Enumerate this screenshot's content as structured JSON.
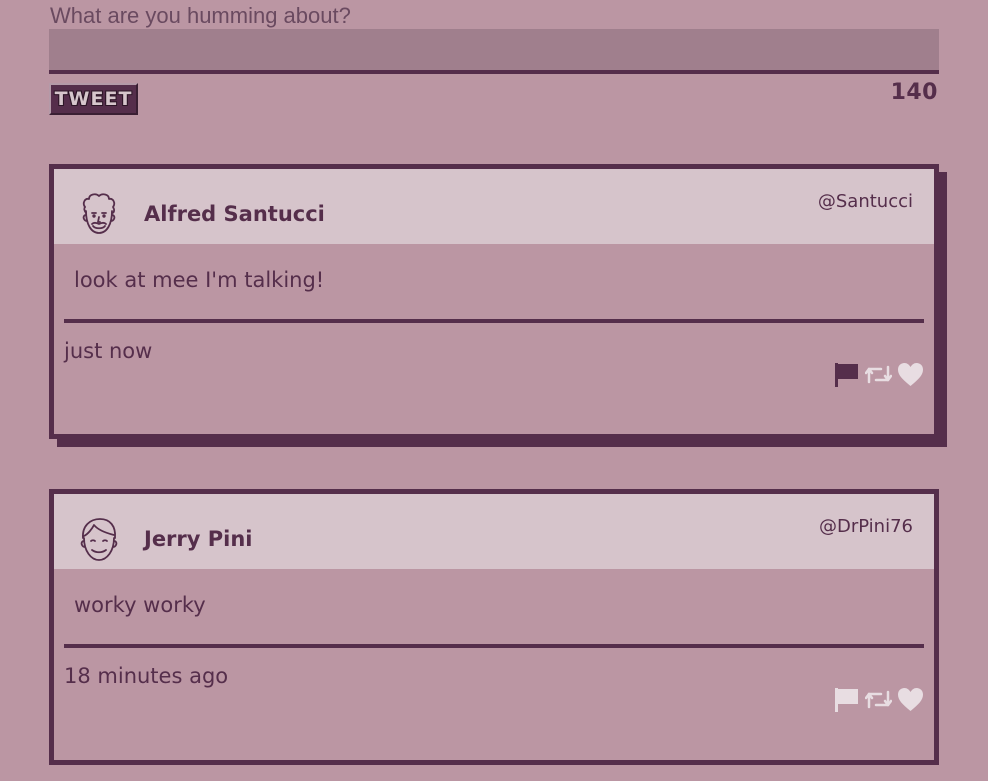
{
  "composer": {
    "prompt": "What are you humming about?",
    "input_value": "",
    "tweet_button_label": "TWEET",
    "char_count": "140"
  },
  "tweets": [
    {
      "user_name": "Alfred Santucci",
      "handle": "@Santucci",
      "text": "look at mee I'm talking!",
      "timestamp": "just now",
      "avatar_icon": "man-curly-hair-avatar-icon",
      "flag_color": "#552e4b"
    },
    {
      "user_name": "Jerry Pini",
      "handle": "@DrPini76",
      "text": "worky worky",
      "timestamp": "18 minutes ago",
      "avatar_icon": "man-smiling-avatar-icon",
      "flag_color": "#e8dde2"
    }
  ],
  "colors": {
    "background": "#bb96a3",
    "accent": "#552e4b",
    "header": "#d6c4cb",
    "input": "#a07f8d",
    "icon_light": "#e8dde2"
  }
}
